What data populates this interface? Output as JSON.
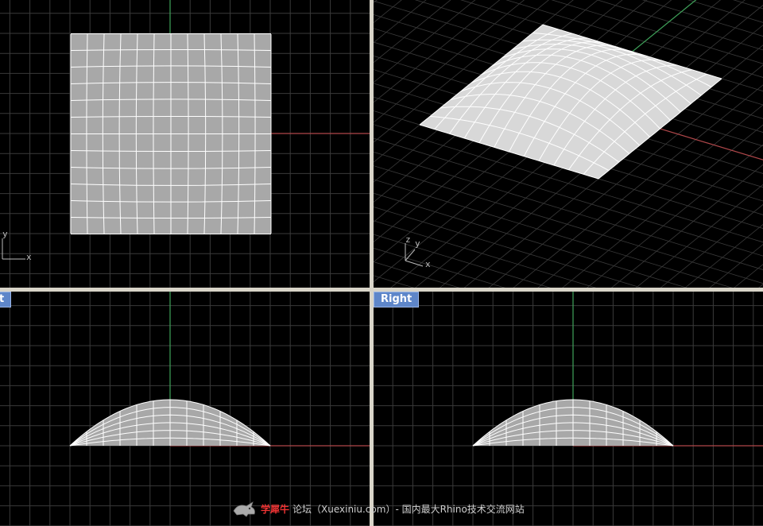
{
  "viewports": {
    "top": {
      "axis_x": "x",
      "axis_y": "y"
    },
    "perspective": {
      "axis_x": "x",
      "axis_y": "y",
      "axis_z": "z"
    },
    "front": {
      "label": "t"
    },
    "right": {
      "label": "Right"
    }
  },
  "watermark": {
    "brand": "学犀牛",
    "text": "论坛（Xuexiniu.com）- 国内最大Rhino技术交流网站",
    "logo_icon": "rhino-logo-icon"
  },
  "colors": {
    "background": "#000000",
    "grid": "#3a3a3a",
    "grid_major": "#4f4f4f",
    "axis_x": "#b0474a",
    "axis_y": "#3fa35a",
    "surface": "#a8a8a8",
    "isocurve": "#ffffff",
    "label_bg": "#5e86c9",
    "divider": "#d8d4c8"
  }
}
